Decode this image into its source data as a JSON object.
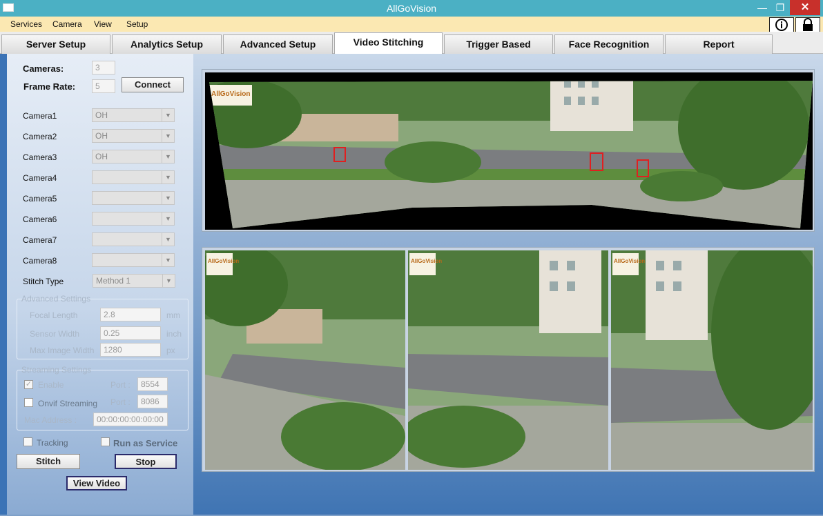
{
  "window": {
    "title": "AllGoVision"
  },
  "menu": {
    "items": [
      "Services",
      "Camera",
      "View",
      "Setup"
    ]
  },
  "tabs": [
    "Server Setup",
    "Analytics Setup",
    "Advanced Setup",
    "Video Stitching",
    "Trigger Based",
    "Face Recognition",
    "Report"
  ],
  "active_tab": "Video Stitching",
  "left_panel": {
    "cameras_label": "Cameras:",
    "cameras_value": "3",
    "frame_rate_label": "Frame Rate:",
    "frame_rate_value": "5",
    "connect_label": "Connect",
    "camera_rows": [
      {
        "label": "Camera1",
        "value": "OH"
      },
      {
        "label": "Camera2",
        "value": "OH"
      },
      {
        "label": "Camera3",
        "value": "OH"
      },
      {
        "label": "Camera4",
        "value": ""
      },
      {
        "label": "Camera5",
        "value": ""
      },
      {
        "label": "Camera6",
        "value": ""
      },
      {
        "label": "Camera7",
        "value": ""
      },
      {
        "label": "Camera8",
        "value": ""
      }
    ],
    "stitch_type_label": "Stitch Type",
    "stitch_type_value": "Method 1",
    "advanced": {
      "title": "Advanced Settings",
      "focal_length_label": "Focal Length",
      "focal_length_value": "2.8",
      "focal_length_unit": "mm",
      "sensor_width_label": "Sensor Width",
      "sensor_width_value": "0.25",
      "sensor_width_unit": "inch",
      "max_image_width_label": "Max Image Width",
      "max_image_width_value": "1280",
      "max_image_width_unit": "px"
    },
    "streaming": {
      "title": "Streaming Settings",
      "enable_label": "Enable",
      "enable_checked": true,
      "port_label": "Port :",
      "port1_value": "8554",
      "onvif_label": "Onvif Streaming",
      "onvif_checked": false,
      "port2_value": "8086",
      "mac_label": "Mac Address :",
      "mac_value": "00:00:00:00:00:00"
    },
    "tracking_label": "Tracking",
    "run_as_service_label": "Run as Service",
    "stitch_label": "Stitch",
    "stop_label": "Stop",
    "view_video_label": "View Video"
  },
  "video": {
    "watermark": "AllGoVision"
  },
  "colors": {
    "titlebar": "#4bb0c4",
    "menubar": "#fbe8b2",
    "close_button": "#c8302b",
    "detection_box": "#e02020"
  }
}
